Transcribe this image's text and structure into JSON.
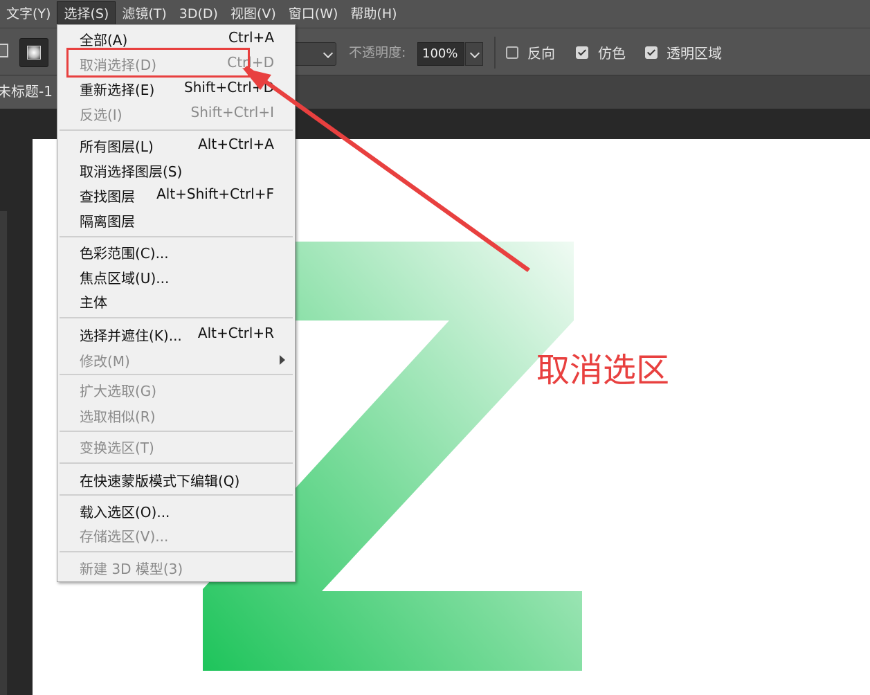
{
  "menubar": {
    "items": [
      "文字(Y)",
      "选择(S)",
      "滤镜(T)",
      "3D(D)",
      "视图(V)",
      "窗口(W)",
      "帮助(H)"
    ]
  },
  "options": {
    "opacity_label": "不透明度:",
    "opacity_value": "100%",
    "reverse_label": "反向",
    "dither_label": "仿色",
    "transparency_label": "透明区域",
    "reverse_checked": false,
    "dither_checked": true,
    "transparency_checked": true
  },
  "document": {
    "tab_title": "未标题-1"
  },
  "select_menu": {
    "items": [
      {
        "label": "全部(A)",
        "shortcut": "Ctrl+A",
        "disabled": false
      },
      {
        "label": "取消选择(D)",
        "shortcut": "Ctrl+D",
        "disabled": true
      },
      {
        "label": "重新选择(E)",
        "shortcut": "Shift+Ctrl+D",
        "disabled": false
      },
      {
        "label": "反选(I)",
        "shortcut": "Shift+Ctrl+I",
        "disabled": true
      },
      {
        "label": "所有图层(L)",
        "shortcut": "Alt+Ctrl+A",
        "disabled": false
      },
      {
        "label": "取消选择图层(S)",
        "shortcut": "",
        "disabled": false
      },
      {
        "label": "查找图层",
        "shortcut": "Alt+Shift+Ctrl+F",
        "disabled": false
      },
      {
        "label": "隔离图层",
        "shortcut": "",
        "disabled": false
      },
      {
        "label": "色彩范围(C)...",
        "shortcut": "",
        "disabled": false
      },
      {
        "label": "焦点区域(U)...",
        "shortcut": "",
        "disabled": false
      },
      {
        "label": "主体",
        "shortcut": "",
        "disabled": false
      },
      {
        "label": "选择并遮住(K)...",
        "shortcut": "Alt+Ctrl+R",
        "disabled": false
      },
      {
        "label": "修改(M)",
        "shortcut": "",
        "disabled": true
      },
      {
        "label": "扩大选取(G)",
        "shortcut": "",
        "disabled": true
      },
      {
        "label": "选取相似(R)",
        "shortcut": "",
        "disabled": true
      },
      {
        "label": "变换选区(T)",
        "shortcut": "",
        "disabled": true
      },
      {
        "label": "在快速蒙版模式下编辑(Q)",
        "shortcut": "",
        "disabled": false
      },
      {
        "label": "载入选区(O)...",
        "shortcut": "",
        "disabled": false
      },
      {
        "label": "存储选区(V)...",
        "shortcut": "",
        "disabled": true
      },
      {
        "label": "新建 3D 模型(3)",
        "shortcut": "",
        "disabled": true
      }
    ]
  },
  "annotation": {
    "text": "取消选区",
    "color": "#e8403f"
  },
  "colors": {
    "z_dark": "#22c55e",
    "z_light": "#e8f8ee",
    "panel": "#535353"
  }
}
